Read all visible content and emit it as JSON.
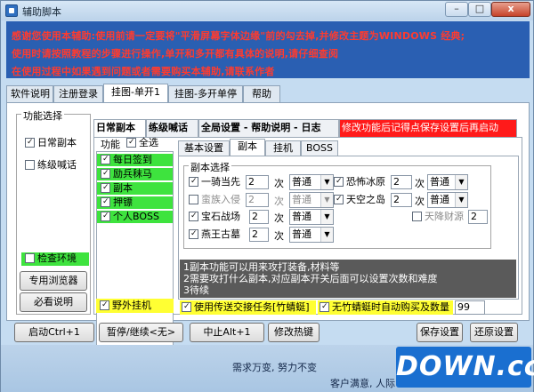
{
  "window": {
    "title": "辅助脚本",
    "min": "–",
    "max": "□",
    "close": "x"
  },
  "notice": {
    "line1": "感谢您使用本辅助:使用前请一定要将\"平滑屏幕字体边缘\"前的勾去掉,并修改主题为WINDOWS 经典;",
    "line2": "使用时请按照教程的步骤进行操作,单开和多开都有具体的说明,请仔细查阅",
    "line3": "在使用过程中如果遇到问题或者需要购买本辅助,请联系作者"
  },
  "main_tabs": [
    "软件说明",
    "注册登录",
    "挂图-单开1",
    "挂图-多开单停",
    "帮助"
  ],
  "left": {
    "group": "功能选择",
    "daily": "日常副本",
    "leveling": "练级喊话",
    "check_env": "检查环境",
    "browser": "专用浏览器",
    "must_read": "必看说明",
    "field_hang": "野外挂机"
  },
  "sub_tabs": {
    "daily": "日常副本",
    "shout": "练级喊话",
    "settings": "全局设置 - 帮助说明 - 日志",
    "warning": "修改功能后记得点保存设置后再启动"
  },
  "func": {
    "label": "功能",
    "select_all": "全选",
    "items": [
      "每日签到",
      "励兵秣马",
      "副本",
      "押镖",
      "个人BOSS"
    ]
  },
  "inner_tabs": [
    "基本设置",
    "副本",
    "挂机",
    "BOSS"
  ],
  "dungeon": {
    "group": "副本选择",
    "times": "次",
    "rows": [
      {
        "name": "一骑当先",
        "count": "2",
        "mode": "普通",
        "checked": true,
        "enabled": true
      },
      {
        "name": "恐怖冰原",
        "count": "2",
        "mode": "普通",
        "checked": true,
        "enabled": true
      },
      {
        "name": "蛮族入侵",
        "count": "2",
        "mode": "普通",
        "checked": false,
        "enabled": false
      },
      {
        "name": "天空之岛",
        "count": "2",
        "mode": "普通",
        "checked": true,
        "enabled": true
      },
      {
        "name": "天降财源",
        "count": "2",
        "checked": false,
        "enabled": false
      },
      {
        "name": "宝石战场",
        "count": "2",
        "mode": "普通",
        "checked": true,
        "enabled": true
      },
      {
        "name": "燕王古墓",
        "count": "2",
        "mode": "普通",
        "checked": true,
        "enabled": true
      }
    ]
  },
  "info": {
    "line1": "1副本功能可以用来攻打装备,材料等",
    "line2": "2需要攻打什么副本,对应副本开关后面可以设置次数和难度",
    "line3": "3待续"
  },
  "escort": {
    "transfer": "使用传送交接任务[竹蜻蜓]",
    "auto_buy": "无竹蜻蜓时自动购买及数量",
    "qty": "99"
  },
  "buttons": {
    "start": "启动Ctrl+1",
    "pause": "暂停/继续<无>",
    "stop": "中止Alt+1",
    "modify": "修改热键",
    "save": "保存设置",
    "restore": "还原设置"
  },
  "footer": {
    "line1": "需求万变, 努力不变",
    "line2": "客户满意, 人际",
    "watermark": "DOWN.cc"
  },
  "colors": {
    "notice_bg": "#2a5fb2",
    "notice_text": "#ff3b2f",
    "green": "#3ee33e",
    "yellow": "#ffff33",
    "warning_bg": "#ff1a1a",
    "info_bg": "#5a5a5a"
  }
}
